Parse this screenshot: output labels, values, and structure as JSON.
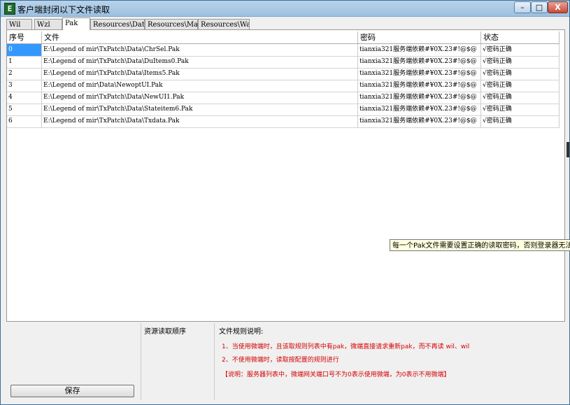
{
  "window": {
    "title": "客户端封闭以下文件读取",
    "icon_glyph": "E",
    "minimize": "–",
    "maximize": "□",
    "close": "X"
  },
  "tabs": [
    {
      "label": "Wil",
      "active": false
    },
    {
      "label": "Wzl",
      "active": false
    },
    {
      "label": "Pak",
      "active": true
    },
    {
      "label": "Resources\\Data",
      "active": false
    },
    {
      "label": "Resources\\Map",
      "active": false
    },
    {
      "label": "Resources\\Wav",
      "active": false
    }
  ],
  "grid": {
    "headers": [
      "序号",
      "文件",
      "密码",
      "状态"
    ],
    "rows": [
      [
        "0",
        "E:\\Legend of mir\\TxPatch\\Data\\ChrSel.Pak",
        "tianxia321服务端依赖#¥0X.23#!@$@",
        "√密码正确"
      ],
      [
        "1",
        "E:\\Legend of mir\\TxPatch\\Data\\DuItems0.Pak",
        "tianxia321服务端依赖#¥0X.23#!@$@",
        "√密码正确"
      ],
      [
        "2",
        "E:\\Legend of mir\\TxPatch\\Data\\Items5.Pak",
        "tianxia321服务端依赖#¥0X.23#!@$@",
        "√密码正确"
      ],
      [
        "3",
        "E:\\Legend of mir\\Data\\NewoptUI.Pak",
        "tianxia321服务端依赖#¥0X.23#!@$@",
        "√密码正确"
      ],
      [
        "4",
        "E:\\Legend of mir\\TxPatch\\Data\\NewUI1.Pak",
        "tianxia321服务端依赖#¥0X.23#!@$@",
        "√密码正确"
      ],
      [
        "5",
        "E:\\Legend of mir\\TxPatch\\Data\\Stateitem6.Pak",
        "tianxia321服务端依赖#¥0X.23#!@$@",
        "√密码正确"
      ],
      [
        "6",
        "E:\\Legend of mir\\TxPatch\\Data\\Txdata.Pak",
        "tianxia321服务端依赖#¥0X.23#!@$@",
        "√密码正确"
      ]
    ],
    "selected_index": 0
  },
  "tooltip": "每一个Pak文件需要设置正确的读取密码，否则登录器无法",
  "bottom": {
    "save_label": "保存",
    "load_order_label": "资源读取顺序",
    "rules_label": "文件规则说明:",
    "rules": [
      "1、当使用微端时，且该取规则列表中有pak，微端直接请求重新pak，而不再读 wil、wil",
      "2、不使用微端时，读取按配置的规则进行",
      "【说明：服务器列表中，微端网关端口号不为0表示使用微端，为0表示不用微端】"
    ]
  },
  "colors": {
    "selection": "#3399ff",
    "rule_text": "#d40000",
    "tooltip_bg": "#ffffe1"
  }
}
